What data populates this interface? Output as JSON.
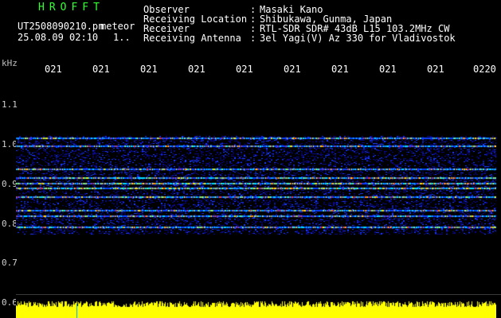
{
  "header": {
    "logo": "HROFFT",
    "filename": "UT2508090210.pn",
    "mode": "meteor",
    "datetime": "25.08.09 02:10",
    "page_indicator": "1..",
    "fields": [
      {
        "label": "Observer",
        "sep": ":",
        "value": "Masaki Kano"
      },
      {
        "label": "Receiving Location",
        "sep": ":",
        "value": "Shibukawa, Gunma, Japan"
      },
      {
        "label": "Receiver",
        "sep": ":",
        "value": "RTL-SDR SDR# 43dB L15 103.2MHz CW"
      },
      {
        "label": "Receiving Antenna",
        "sep": ":",
        "value": "3el Yagi(V) Az 330 for Vladivostok"
      }
    ]
  },
  "axis": {
    "unit": "kHz",
    "time_ticks": [
      "021",
      "021",
      "021",
      "021",
      "021",
      "021",
      "021",
      "021",
      "021",
      "0220"
    ],
    "freq_labels": [
      "1.1",
      "1.0",
      "0.9",
      "0.8",
      "0.7",
      "0.6"
    ]
  },
  "colors": {
    "background": "#000000",
    "logo": "#33ff33",
    "text": "#ffffff",
    "signal_low": "#0000c0",
    "signal_mid": "#00ffff",
    "signal_high": "#ff2020",
    "bottom_bar": "#ffff00"
  }
}
